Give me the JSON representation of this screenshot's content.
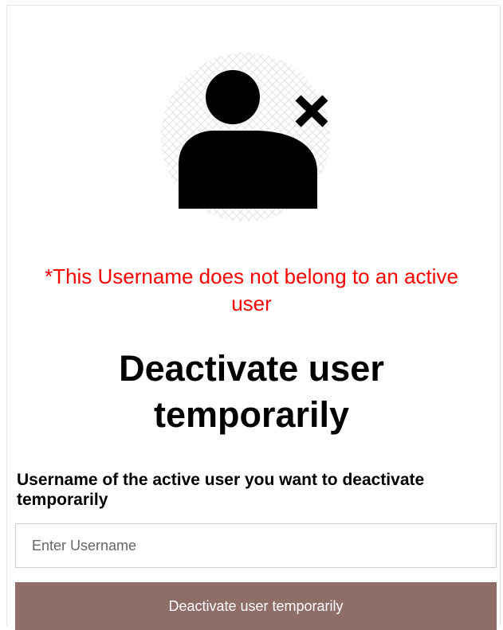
{
  "status": {
    "icon": "user-remove-icon",
    "error_message": "*This Username does not belong to an active user",
    "error_color": "#ff0000"
  },
  "form": {
    "title": "Deactivate user temporarily",
    "username_label": "Username of the active user you want to deactivate temporarily",
    "username_placeholder": "Enter Username",
    "username_value": "",
    "submit_label": "Deactivate user temporarily",
    "submit_color": "#8f6d69"
  }
}
